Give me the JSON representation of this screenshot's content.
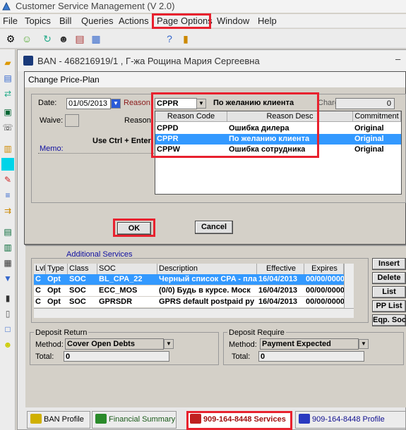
{
  "app": {
    "title": "Customer Service Management  (V 2.0)",
    "menu": [
      "File",
      "Topics",
      "Bill",
      "Queries",
      "Actions",
      "Page Options",
      "Window",
      "Help"
    ]
  },
  "ban_window": {
    "title": "BAN - 468216919/1 , Г-жа Рощина Мария Сергеевна"
  },
  "dialog": {
    "title": "Change Price-Plan",
    "date_label": "Date:",
    "date_value": "01/05/2013",
    "reason_label": "Reason:",
    "reason_code": "CPPR",
    "reason_desc": "По желанию клиента",
    "charge_label": "Charge:",
    "charge_value": "0",
    "waive_label": "Waive:",
    "reason2_label": "Reason:",
    "hint": "Use Ctrl + Enter",
    "memo_label": "Memo:",
    "ok_label": "OK",
    "cancel_label": "Cancel"
  },
  "reason_list": {
    "headers": [
      "Reason Code",
      "Reason Desc",
      "Commitment"
    ],
    "rows": [
      {
        "code": "CPPD",
        "desc": "Ошибка дилера",
        "commitment": "Original"
      },
      {
        "code": "CPPR",
        "desc": "По желанию клиента",
        "commitment": "Original"
      },
      {
        "code": "CPPW",
        "desc": "Ошибка сотрудника",
        "commitment": "Original"
      }
    ],
    "selected_index": 1
  },
  "additional_services": {
    "title": "Additional Services",
    "headers": [
      "Lvl",
      "Type",
      "Class",
      "SOC",
      "Description",
      "Effective",
      "Expires"
    ],
    "rows": [
      {
        "lvl": "C",
        "type": "Opt",
        "class": "SOC",
        "soc": "BL_CPA_22",
        "desc": "Черный список CPA - пла",
        "eff": "16/04/2013",
        "exp": "00/00/0000"
      },
      {
        "lvl": "C",
        "type": "Opt",
        "class": "SOC",
        "soc": "ECC_MOS",
        "desc": "(0/0) Будь в курсе. Моск",
        "eff": "16/04/2013",
        "exp": "00/00/0000"
      },
      {
        "lvl": "C",
        "type": "Opt",
        "class": "SOC",
        "soc": "GPRSDR",
        "desc": "GPRS default postpaid py",
        "eff": "16/04/2013",
        "exp": "00/00/0000"
      }
    ],
    "side_buttons": [
      "Insert",
      "Delete",
      "List",
      "PP List",
      "Eqp. Soc"
    ]
  },
  "deposit_return": {
    "title": "Deposit Return",
    "method_label": "Method:",
    "method_value": "Cover Open Debts",
    "total_label": "Total:",
    "total_value": "0"
  },
  "deposit_require": {
    "title": "Deposit Require",
    "method_label": "Method:",
    "method_value": "Payment Expected",
    "total_label": "Total:",
    "total_value": "0"
  },
  "bottom_tabs": [
    "BAN Profile",
    "Financial Summary",
    "909-164-8448 Services",
    "909-164-8448 Profile"
  ],
  "colors": {
    "highlight": "#e8212e",
    "selection": "#3399ff",
    "section_title": "#1010a0"
  }
}
